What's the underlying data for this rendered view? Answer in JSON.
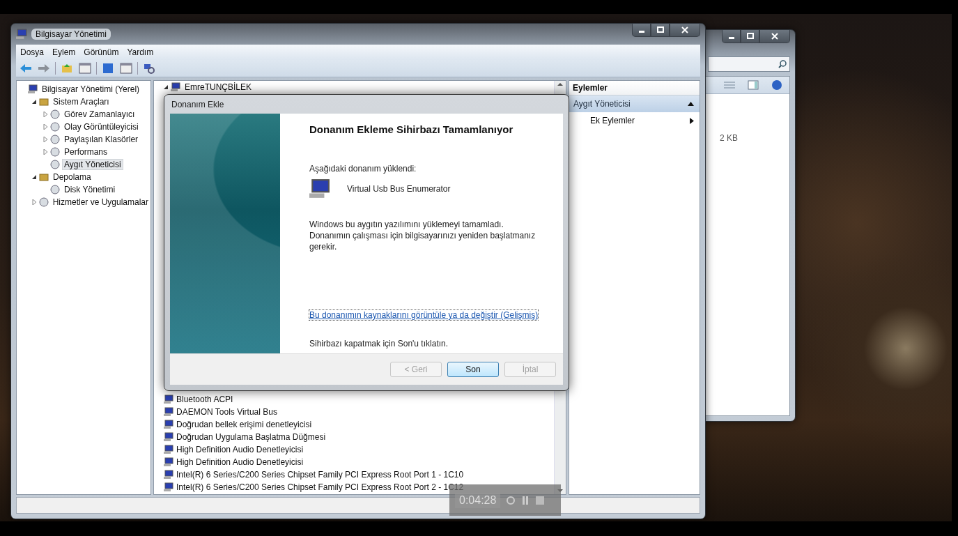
{
  "main_window": {
    "title": "Bilgisayar Yönetimi",
    "menu": [
      "Dosya",
      "Eylem",
      "Görünüm",
      "Yardım"
    ],
    "tree": [
      {
        "label": "Bilgisayar Yönetimi (Yerel)",
        "selected": false,
        "children": [
          {
            "label": "Sistem Araçları",
            "selected": false,
            "expanded": true,
            "children": [
              {
                "label": "Görev Zamanlayıcı",
                "selected": false,
                "expanded": false
              },
              {
                "label": "Olay Görüntüleyicisi",
                "selected": false,
                "expanded": false
              },
              {
                "label": "Paylaşılan Klasörler",
                "selected": false,
                "expanded": false
              },
              {
                "label": "Performans",
                "selected": false,
                "expanded": false
              },
              {
                "label": "Aygıt Yöneticisi",
                "selected": true
              }
            ]
          },
          {
            "label": "Depolama",
            "selected": false,
            "expanded": true,
            "children": [
              {
                "label": "Disk Yönetimi",
                "selected": false
              }
            ]
          },
          {
            "label": "Hizmetler ve Uygulamalar",
            "selected": false,
            "expanded": false
          }
        ]
      }
    ],
    "device_root": "EmreTUNÇBİLEK",
    "devices": [
      "Bluetooth ACPI",
      "DAEMON Tools Virtual Bus",
      "Doğrudan bellek erişimi denetleyicisi",
      "Doğrudan Uygulama Başlatma Düğmesi",
      "High Definition Audio Denetleyicisi",
      "High Definition Audio Denetleyicisi",
      "Intel(R) 6 Series/C200 Series Chipset Family PCI Express Root Port 1 - 1C10",
      "Intel(R) 6 Series/C200 Series Chipset Family PCI Express Root Port 2 - 1C12"
    ],
    "actions": {
      "header": "Eylemler",
      "section": "Aygıt Yöneticisi",
      "items": [
        "Ek Eylemler"
      ]
    }
  },
  "second_window": {
    "file_size": "2 KB"
  },
  "dialog": {
    "title": "Donanım Ekle",
    "heading": "Donanım Ekleme Sihirbazı Tamamlanıyor",
    "installed_label": "Aşağıdaki donanım yüklendi:",
    "device": "Virtual Usb Bus Enumerator",
    "message": "Windows bu aygıtın yazılımını yüklemeyi tamamladı. Donanımın çalışması için bilgisayarınızı yeniden başlatmanız gerekir.",
    "link": "Bu donanımın kaynaklarını görüntüle ya da değiştir (Gelişmiş)",
    "footer": "Sihirbazı kapatmak için Son'u tıklatın.",
    "buttons": [
      {
        "label": "< Geri",
        "disabled": true,
        "default": false
      },
      {
        "label": "Son",
        "disabled": false,
        "default": true
      },
      {
        "label": "İptal",
        "disabled": true,
        "default": false
      }
    ]
  },
  "recorder": {
    "time": "0:04:28"
  }
}
